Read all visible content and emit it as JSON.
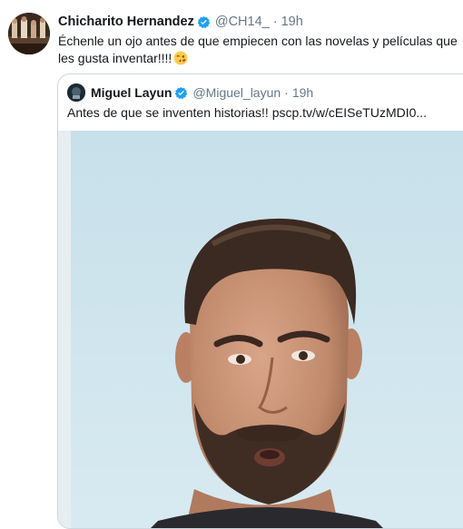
{
  "tweet": {
    "author_name": "Chicharito Hernandez",
    "author_handle": "@CH14_",
    "separator": "·",
    "time": "19h",
    "text": "Échenle un ojo antes de que empiecen con las novelas y películas que les gusta inventar!!!!"
  },
  "quoted_tweet": {
    "author_name": "Miguel Layun",
    "author_handle": "@Miguel_layun",
    "separator": "·",
    "time": "19h",
    "text": "Antes de que se inventen historias!! pscp.tv/w/cEISeTUzMDI0..."
  },
  "icons": {
    "verified": "verified-badge-icon",
    "emoji": "kissing-face-emoji"
  },
  "colors": {
    "verified_blue": "#1da1f2",
    "secondary_text": "#657786",
    "border": "#ccd6dd"
  }
}
